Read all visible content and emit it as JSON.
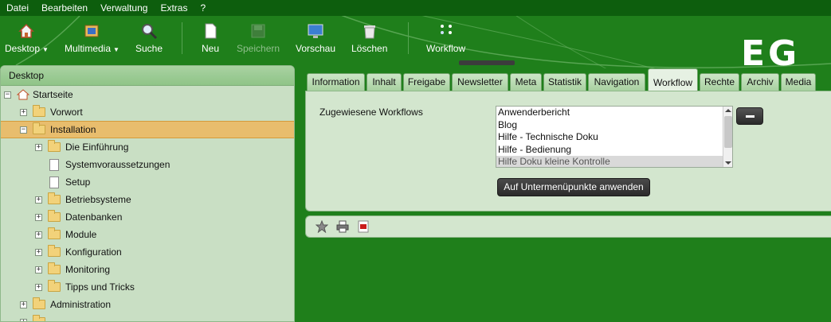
{
  "menubar": [
    "Datei",
    "Bearbeiten",
    "Verwaltung",
    "Extras",
    "?"
  ],
  "toolbar": {
    "desktop": "Desktop",
    "multimedia": "Multimedia",
    "suche": "Suche",
    "neu": "Neu",
    "speichern": "Speichern",
    "vorschau": "Vorschau",
    "loeschen": "Löschen",
    "workflow": "Workflow",
    "logo": "EG"
  },
  "left": {
    "title": "Desktop",
    "tree": [
      {
        "label": "Startseite"
      },
      {
        "label": "Vorwort"
      },
      {
        "label": "Installation"
      },
      {
        "label": "Die Einführung"
      },
      {
        "label": "Systemvoraussetzungen"
      },
      {
        "label": "Setup"
      },
      {
        "label": "Betriebsysteme"
      },
      {
        "label": "Datenbanken"
      },
      {
        "label": "Module"
      },
      {
        "label": "Konfiguration"
      },
      {
        "label": "Monitoring"
      },
      {
        "label": "Tipps und Tricks"
      },
      {
        "label": "Administration"
      }
    ]
  },
  "tabs": [
    "Information",
    "Inhalt",
    "Freigabe",
    "Newsletter",
    "Meta",
    "Statistik",
    "Navigation",
    "Workflow",
    "Rechte",
    "Archiv",
    "Media"
  ],
  "active_tab": "Workflow",
  "content": {
    "label": "Zugewiesene Workflows",
    "options": [
      "Anwenderbericht",
      "Blog",
      "Hilfe - Technische Doku",
      "Hilfe - Bedienung",
      "Hilfe Doku kleine Kontrolle"
    ],
    "apply_button": "Auf Untermenüpunkte anwenden"
  },
  "colors": {
    "background": "#1f7f1b",
    "menubar": "#0d5e0d",
    "panel": "#c9dfc4",
    "selected": "#e8bd6d"
  }
}
